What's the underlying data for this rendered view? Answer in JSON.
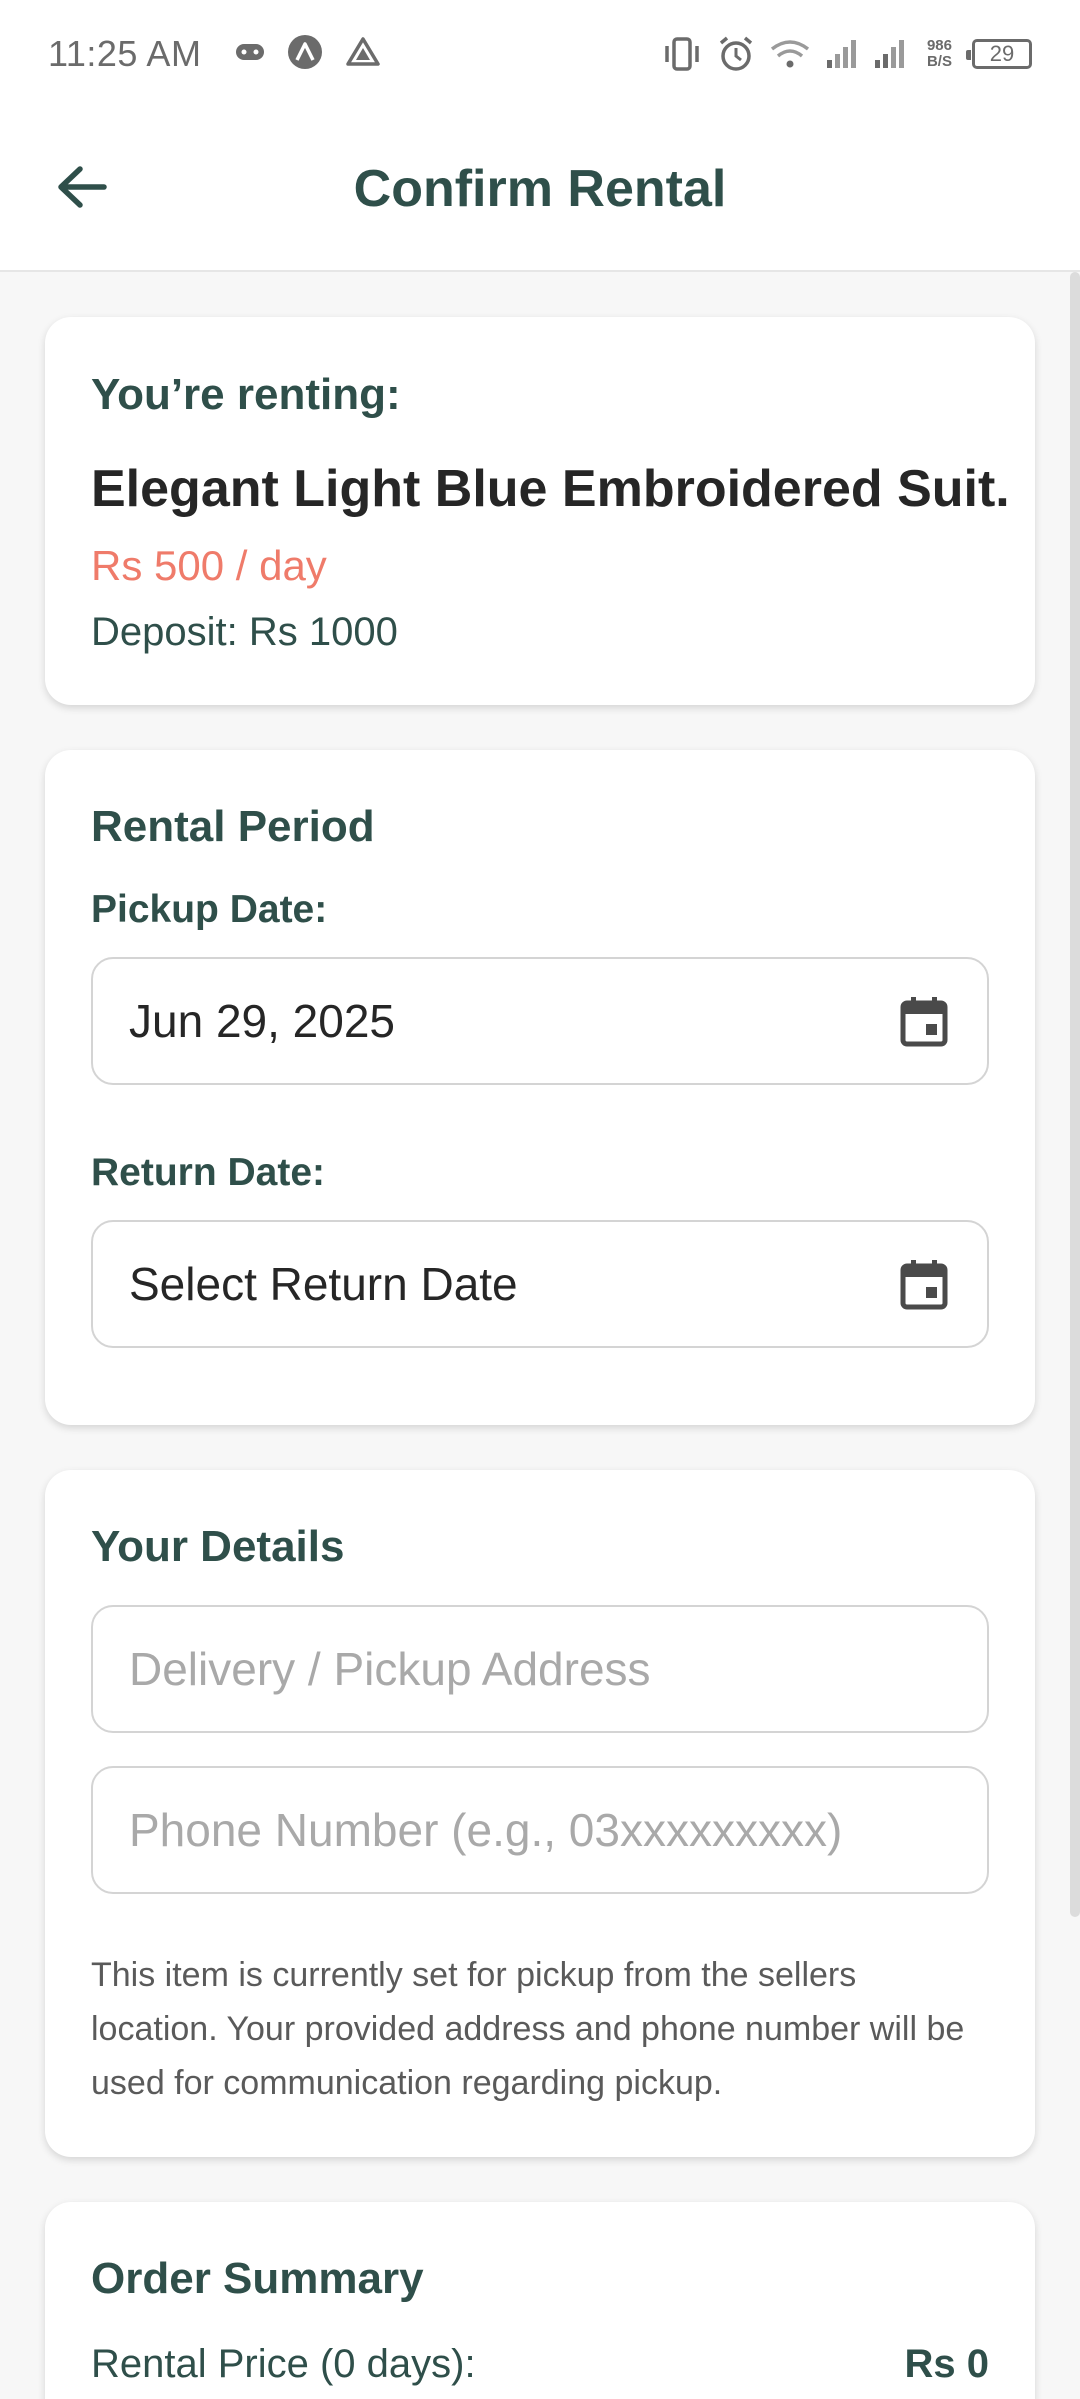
{
  "status_bar": {
    "time": "11:25 AM",
    "net_speed_value": "986",
    "net_speed_unit": "B/S",
    "battery_level": "29",
    "icons": [
      "game-controller-icon",
      "app-a-icon",
      "drive-icon",
      "vibrate-icon",
      "alarm-icon",
      "wifi-icon",
      "signal-icon",
      "signal-icon"
    ]
  },
  "header": {
    "title": "Confirm Rental",
    "back_icon": "arrow-left-icon"
  },
  "item_card": {
    "label": "You’re renting:",
    "name": "Elegant Light Blue Embroidered Suit.",
    "price": "Rs 500 / day",
    "deposit": "Deposit: Rs 1000"
  },
  "rental_period": {
    "title": "Rental Period",
    "pickup_label": "Pickup Date:",
    "pickup_value": "Jun 29, 2025",
    "return_label": "Return Date:",
    "return_value": "Select Return Date",
    "calendar_icon": "calendar-icon"
  },
  "details": {
    "title": "Your Details",
    "address_placeholder": "Delivery / Pickup Address",
    "phone_placeholder": "Phone Number (e.g., 03xxxxxxxxx)",
    "note": "This item is currently set for pickup from the sellers location. Your provided address and phone number will be used for communication regarding pickup."
  },
  "summary": {
    "title": "Order Summary",
    "rental_price_label": "Rental Price (0 days):",
    "rental_price_value": "Rs 0"
  },
  "colors": {
    "primary_text": "#2f4f4a",
    "price_accent": "#ef7b6a",
    "background": "#f7f7f7"
  }
}
